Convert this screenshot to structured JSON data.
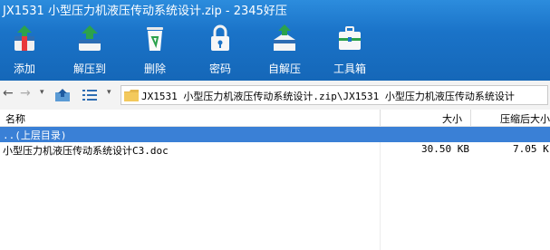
{
  "window": {
    "title": "JX1531 小型压力机液压传动系统设计.zip - 2345好压"
  },
  "toolbar": [
    {
      "label": "添加",
      "icon": "add-archive-icon"
    },
    {
      "label": "解压到",
      "icon": "extract-to-icon"
    },
    {
      "label": "删除",
      "icon": "recycle-bin-icon"
    },
    {
      "label": "密码",
      "icon": "lock-icon"
    },
    {
      "label": "自解压",
      "icon": "self-extract-icon"
    },
    {
      "label": "工具箱",
      "icon": "toolbox-icon"
    }
  ],
  "navigation": {
    "address": "JX1531 小型压力机液压传动系统设计.zip\\JX1531 小型压力机液压传动系统设计"
  },
  "columns": {
    "name": "名称",
    "size": "大小",
    "compressed": "压缩后大小"
  },
  "rows": [
    {
      "name": "..(上层目录)",
      "size": "",
      "compressed": ""
    },
    {
      "name": "小型压力机液压传动系统设计C3.doc",
      "size": "30.50 KB",
      "compressed": "7.05 K"
    }
  ],
  "colors": {
    "toolbar_bg": "#1a73c8",
    "selection": "#3a80d6"
  }
}
